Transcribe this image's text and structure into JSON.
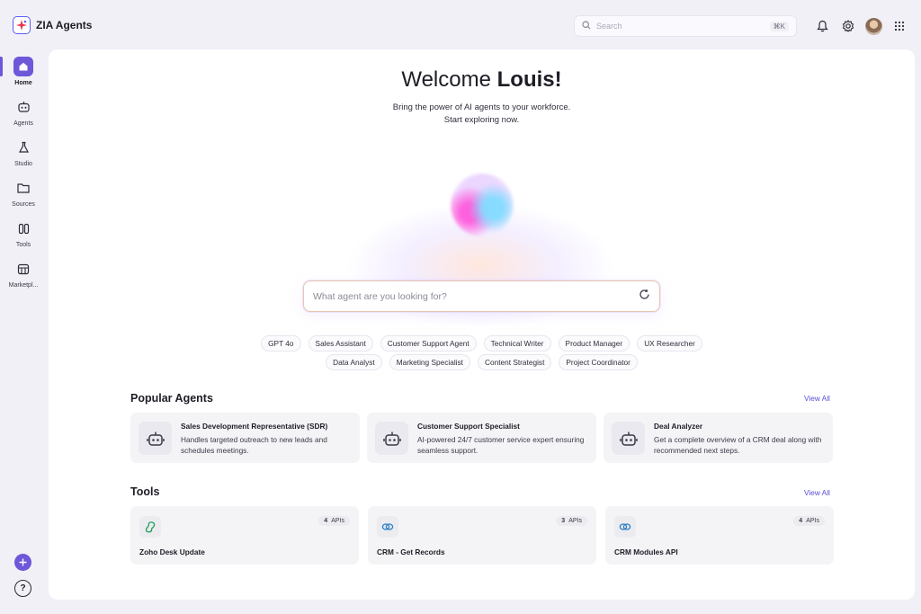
{
  "app": {
    "name": "ZIA Agents"
  },
  "header": {
    "search_placeholder": "Search",
    "search_shortcut": "⌘K",
    "icons": [
      "bell-icon",
      "gear-icon",
      "avatar",
      "grid-icon"
    ]
  },
  "sidebar": {
    "items": [
      {
        "label": "Home",
        "icon": "home-icon",
        "active": true
      },
      {
        "label": "Agents",
        "icon": "robot-icon"
      },
      {
        "label": "Studio",
        "icon": "flask-icon"
      },
      {
        "label": "Sources",
        "icon": "folder-icon"
      },
      {
        "label": "Tools",
        "icon": "tools-icon"
      },
      {
        "label": "Marketpl...",
        "icon": "store-icon"
      }
    ],
    "help_label": "?"
  },
  "hero": {
    "greeting": "Welcome",
    "user": "Louis!",
    "line1": "Bring the power of AI agents to your workforce.",
    "line2": "Start exploring now.",
    "search_placeholder": "What agent are you looking for?"
  },
  "chips": {
    "row1": [
      "GPT 4o",
      "Sales Assistant",
      "Customer Support Agent",
      "Technical Writer",
      "Product Manager",
      "UX Researcher"
    ],
    "row2": [
      "Data Analyst",
      "Marketing Specialist",
      "Content Strategist",
      "Project Coordinator"
    ]
  },
  "popular_agents": {
    "title": "Popular Agents",
    "view_all": "View All",
    "items": [
      {
        "name": "Sales Development Representative (SDR)",
        "desc": "Handles targeted outreach to new leads and schedules meetings."
      },
      {
        "name": "Customer Support Specialist",
        "desc": "AI-powered 24/7 customer service expert ensuring seamless support."
      },
      {
        "name": "Deal Analyzer",
        "desc": "Get a complete overview of a CRM deal along with recommended next steps."
      }
    ]
  },
  "tools": {
    "title": "Tools",
    "view_all": "View All",
    "items": [
      {
        "name": "Zoho Desk Update",
        "count": "4",
        "unit": "APIs",
        "icon": "desk-icon"
      },
      {
        "name": "CRM - Get Records",
        "count": "3",
        "unit": "APIs",
        "icon": "link-icon"
      },
      {
        "name": "CRM Modules API",
        "count": "4",
        "unit": "APIs",
        "icon": "link-icon"
      }
    ]
  },
  "colors": {
    "accent": "#6e57d8",
    "link": "#5a4fd6"
  }
}
